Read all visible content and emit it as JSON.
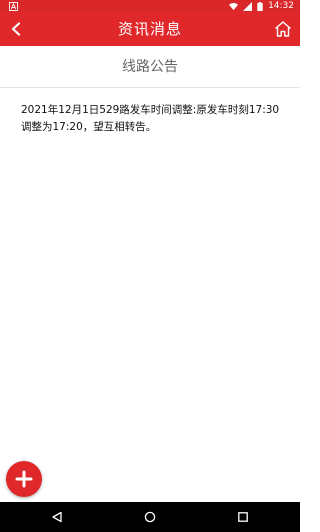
{
  "status_bar": {
    "time": "14:32",
    "icons": [
      "notification-a-icon",
      "wifi-icon",
      "signal-icon",
      "battery-icon"
    ]
  },
  "header": {
    "title": "资讯消息",
    "back_icon": "chevron-left-icon",
    "home_icon": "home-icon",
    "color": "#e0282b"
  },
  "content": {
    "title": "线路公告",
    "body": "2021年12月1日529路发车时间调整:原发车时刻17:30调整为17:20，望互相转告。"
  },
  "fab": {
    "icon": "plus-icon",
    "color": "#e0282b"
  },
  "nav_bar": {
    "icons": [
      "back-triangle-icon",
      "home-circle-icon",
      "recents-square-icon"
    ]
  }
}
